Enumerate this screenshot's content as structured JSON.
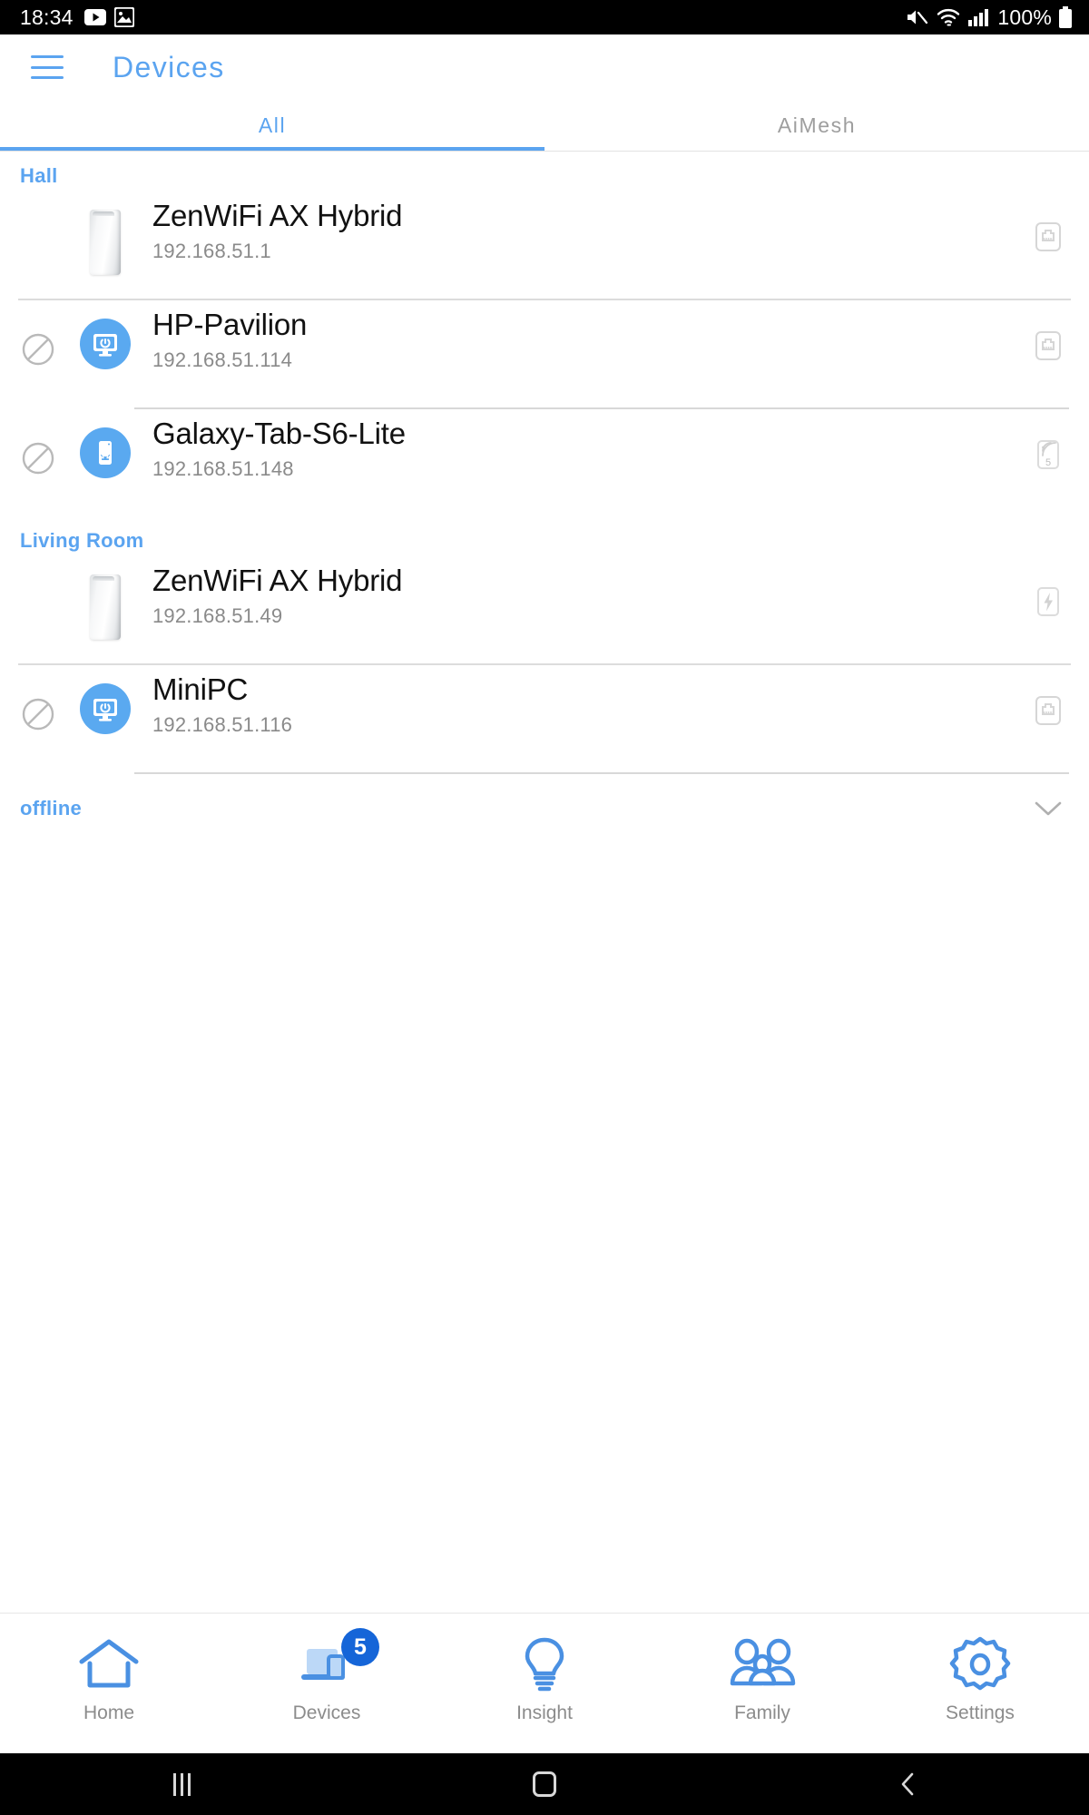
{
  "statusbar": {
    "clock": "18:34",
    "battery_text": "100%",
    "left_icons": [
      "youtube-icon",
      "image-icon"
    ],
    "right_icons": [
      "mute-icon",
      "wifi-icon",
      "signal-icon",
      "battery-icon"
    ]
  },
  "appbar": {
    "menu_icon": "hamburger-menu-icon",
    "title": "Devices",
    "accent_color": "#5ba4f0"
  },
  "tabs": [
    {
      "label": "All",
      "active": true
    },
    {
      "label": "AiMesh",
      "active": false
    }
  ],
  "groups": [
    {
      "name": "Hall",
      "devices": [
        {
          "name": "ZenWiFi AX Hybrid",
          "ip": "192.168.51.1",
          "avatar": "router-image",
          "blocked_icon": false,
          "connection_icon": "ethernet-icon",
          "connection_label": "",
          "divider": "full"
        },
        {
          "name": "HP-Pavilion",
          "ip": "192.168.51.114",
          "avatar": "desktop-power-icon",
          "blocked_icon": true,
          "connection_icon": "ethernet-icon",
          "connection_label": "",
          "divider": "indent"
        },
        {
          "name": "Galaxy-Tab-S6-Lite",
          "ip": "192.168.51.148",
          "avatar": "android-tablet-icon",
          "blocked_icon": true,
          "connection_icon": "wifi-band-icon",
          "connection_label": "5",
          "divider": "none"
        }
      ]
    },
    {
      "name": "Living Room",
      "devices": [
        {
          "name": "ZenWiFi AX Hybrid",
          "ip": "192.168.51.49",
          "avatar": "router-image",
          "blocked_icon": false,
          "connection_icon": "lightning-icon",
          "connection_label": "",
          "divider": "full"
        },
        {
          "name": "MiniPC",
          "ip": "192.168.51.116",
          "avatar": "desktop-power-icon",
          "blocked_icon": true,
          "connection_icon": "ethernet-icon",
          "connection_label": "",
          "divider": "indent"
        }
      ]
    }
  ],
  "offline_section": {
    "label": "offline",
    "expand_icon": "chevron-down-icon"
  },
  "bottom_nav": [
    {
      "label": "Home",
      "icon": "home-icon",
      "badge": "",
      "active": false
    },
    {
      "label": "Devices",
      "icon": "devices-icon",
      "badge": "5",
      "active": true
    },
    {
      "label": "Insight",
      "icon": "lightbulb-icon",
      "badge": "",
      "active": false
    },
    {
      "label": "Family",
      "icon": "family-icon",
      "badge": "",
      "active": false
    },
    {
      "label": "Settings",
      "icon": "gear-icon",
      "badge": "",
      "active": false
    }
  ],
  "android_nav": {
    "recents": "recents-icon",
    "home": "home-circle-icon",
    "back": "back-icon"
  }
}
